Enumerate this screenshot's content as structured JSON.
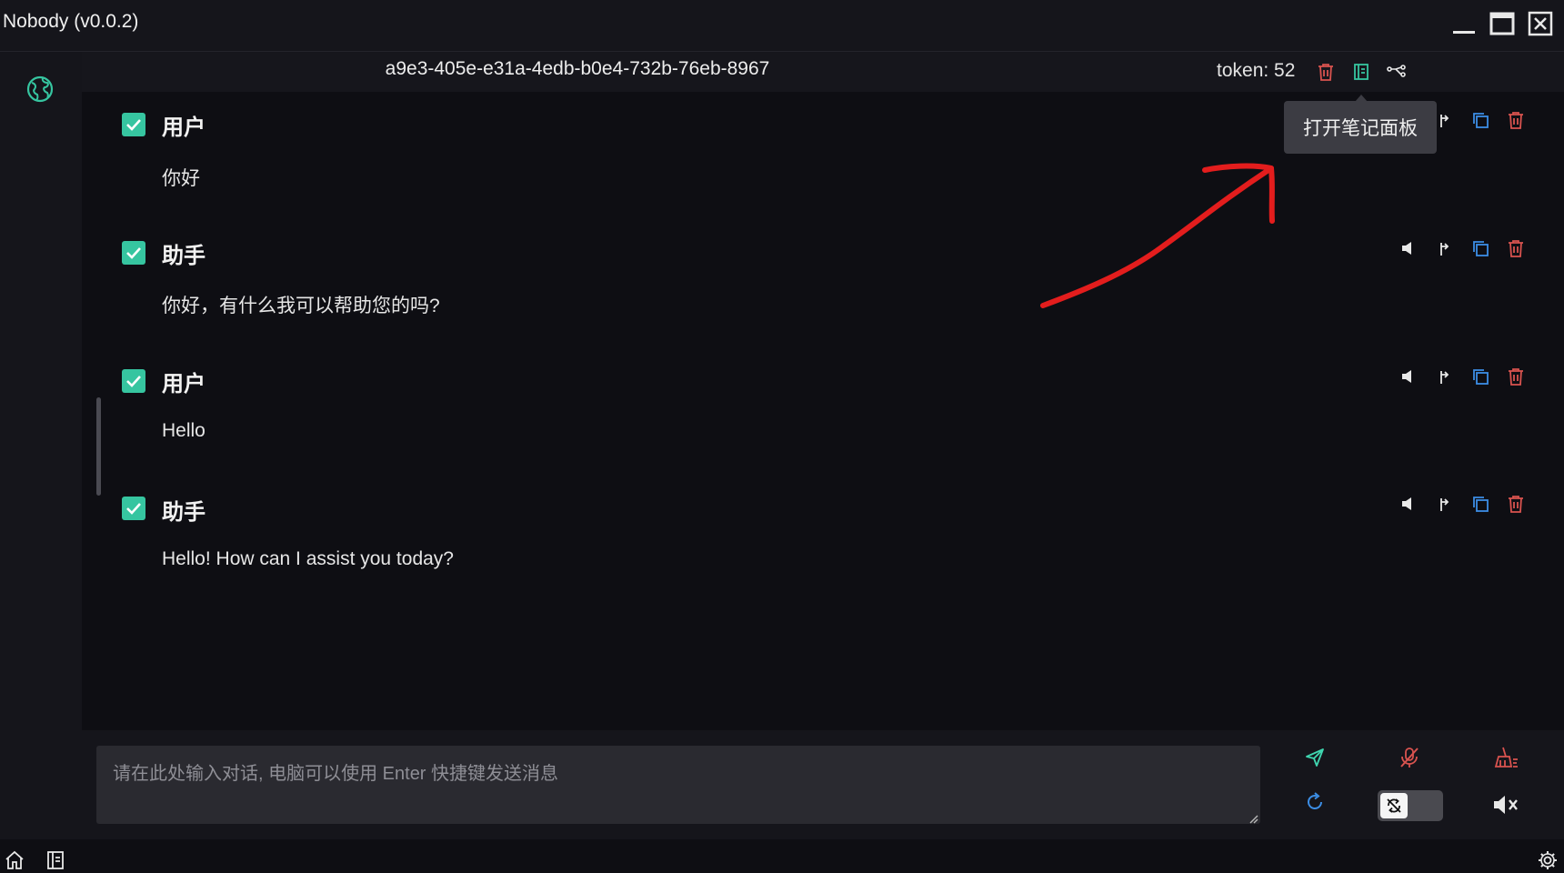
{
  "window": {
    "title": "Nobody (v0.0.2)"
  },
  "header": {
    "session_id": "a9e3-405e-e31a-4edb-b0e4-732b-76eb-8967",
    "token_label": "token: 52",
    "icons": [
      "trash-icon",
      "notebook-icon",
      "share-icon"
    ]
  },
  "tooltip": {
    "text": "打开笔记面板"
  },
  "messages": [
    {
      "role": "用户",
      "content": "你好",
      "checked": true
    },
    {
      "role": "助手",
      "content": "你好，有什么我可以帮助您的吗?",
      "checked": true
    },
    {
      "role": "用户",
      "content": "Hello",
      "checked": true
    },
    {
      "role": "助手",
      "content": "Hello! How can I assist you today?",
      "checked": true
    }
  ],
  "input": {
    "placeholder": "请在此处输入对话, 电脑可以使用 Enter 快捷键发送消息",
    "value": ""
  },
  "colors": {
    "accent": "#36c5a0",
    "danger": "#d9534f",
    "copy": "#3c8ee6",
    "send": "#3fd6b0",
    "annotation": "#e31d1d"
  }
}
